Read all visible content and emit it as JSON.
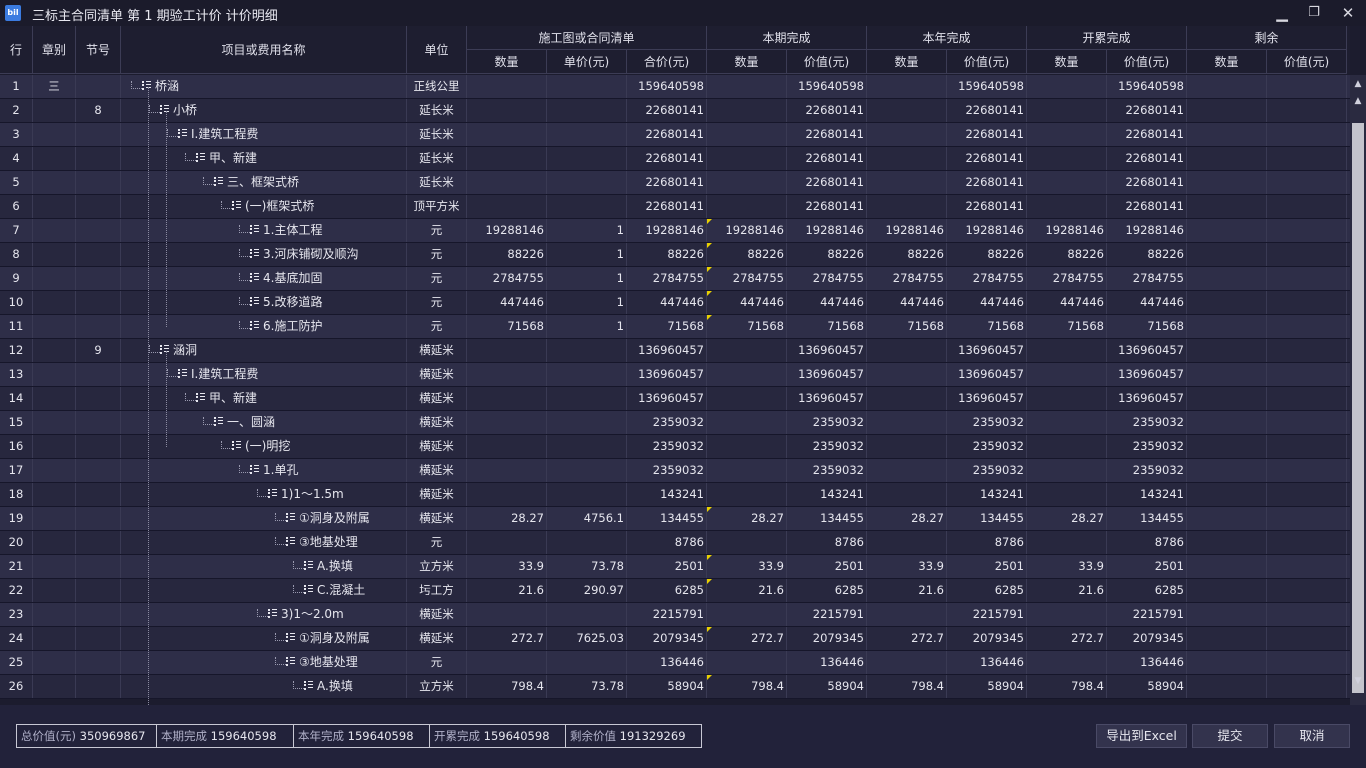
{
  "window": {
    "title": "三标主合同清单 第 1 期验工计价 计价明细",
    "app_icon_text": "bil",
    "minimize": "▁",
    "restore": "❐",
    "close": "✕"
  },
  "header": {
    "col_row": "行",
    "col_chapter": "章别",
    "col_section": "节号",
    "col_name": "项目或费用名称",
    "col_unit": "单位",
    "group_contract": "施工图或合同清单",
    "group_period": "本期完成",
    "group_year": "本年完成",
    "group_cumulative": "开累完成",
    "group_remaining": "剩余",
    "qty": "数量",
    "unit_price": "单价(元)",
    "total_price": "合价(元)",
    "value": "价值(元)"
  },
  "rows": [
    {
      "n": "1",
      "ch": "三",
      "sec": "",
      "lvl": 0,
      "name": "桥涵",
      "unit": "正线公里",
      "q": "",
      "p": "",
      "t": "159640598",
      "pq": "",
      "pv": "159640598",
      "yq": "",
      "yv": "159640598",
      "cq": "",
      "cv": "159640598",
      "flag": false
    },
    {
      "n": "2",
      "ch": "",
      "sec": "8",
      "lvl": 1,
      "name": "小桥",
      "unit": "延长米",
      "q": "",
      "p": "",
      "t": "22680141",
      "pq": "",
      "pv": "22680141",
      "yq": "",
      "yv": "22680141",
      "cq": "",
      "cv": "22680141",
      "flag": false
    },
    {
      "n": "3",
      "ch": "",
      "sec": "",
      "lvl": 2,
      "name": "Ⅰ.建筑工程费",
      "unit": "延长米",
      "q": "",
      "p": "",
      "t": "22680141",
      "pq": "",
      "pv": "22680141",
      "yq": "",
      "yv": "22680141",
      "cq": "",
      "cv": "22680141",
      "flag": false
    },
    {
      "n": "4",
      "ch": "",
      "sec": "",
      "lvl": 3,
      "name": "甲、新建",
      "unit": "延长米",
      "q": "",
      "p": "",
      "t": "22680141",
      "pq": "",
      "pv": "22680141",
      "yq": "",
      "yv": "22680141",
      "cq": "",
      "cv": "22680141",
      "flag": false
    },
    {
      "n": "5",
      "ch": "",
      "sec": "",
      "lvl": 4,
      "name": "三、框架式桥",
      "unit": "延长米",
      "q": "",
      "p": "",
      "t": "22680141",
      "pq": "",
      "pv": "22680141",
      "yq": "",
      "yv": "22680141",
      "cq": "",
      "cv": "22680141",
      "flag": false
    },
    {
      "n": "6",
      "ch": "",
      "sec": "",
      "lvl": 5,
      "name": "(一)框架式桥",
      "unit": "顶平方米",
      "q": "",
      "p": "",
      "t": "22680141",
      "pq": "",
      "pv": "22680141",
      "yq": "",
      "yv": "22680141",
      "cq": "",
      "cv": "22680141",
      "flag": false
    },
    {
      "n": "7",
      "ch": "",
      "sec": "",
      "lvl": 6,
      "name": "1.主体工程",
      "unit": "元",
      "q": "19288146",
      "p": "1",
      "t": "19288146",
      "pq": "19288146",
      "pv": "19288146",
      "yq": "19288146",
      "yv": "19288146",
      "cq": "19288146",
      "cv": "19288146",
      "flag": true
    },
    {
      "n": "8",
      "ch": "",
      "sec": "",
      "lvl": 6,
      "name": "3.河床铺砌及顺沟",
      "unit": "元",
      "q": "88226",
      "p": "1",
      "t": "88226",
      "pq": "88226",
      "pv": "88226",
      "yq": "88226",
      "yv": "88226",
      "cq": "88226",
      "cv": "88226",
      "flag": true
    },
    {
      "n": "9",
      "ch": "",
      "sec": "",
      "lvl": 6,
      "name": "4.基底加固",
      "unit": "元",
      "q": "2784755",
      "p": "1",
      "t": "2784755",
      "pq": "2784755",
      "pv": "2784755",
      "yq": "2784755",
      "yv": "2784755",
      "cq": "2784755",
      "cv": "2784755",
      "flag": true
    },
    {
      "n": "10",
      "ch": "",
      "sec": "",
      "lvl": 6,
      "name": "5.改移道路",
      "unit": "元",
      "q": "447446",
      "p": "1",
      "t": "447446",
      "pq": "447446",
      "pv": "447446",
      "yq": "447446",
      "yv": "447446",
      "cq": "447446",
      "cv": "447446",
      "flag": true
    },
    {
      "n": "11",
      "ch": "",
      "sec": "",
      "lvl": 6,
      "name": "6.施工防护",
      "unit": "元",
      "q": "71568",
      "p": "1",
      "t": "71568",
      "pq": "71568",
      "pv": "71568",
      "yq": "71568",
      "yv": "71568",
      "cq": "71568",
      "cv": "71568",
      "flag": true
    },
    {
      "n": "12",
      "ch": "",
      "sec": "9",
      "lvl": 1,
      "name": "涵洞",
      "unit": "横延米",
      "q": "",
      "p": "",
      "t": "136960457",
      "pq": "",
      "pv": "136960457",
      "yq": "",
      "yv": "136960457",
      "cq": "",
      "cv": "136960457",
      "flag": false
    },
    {
      "n": "13",
      "ch": "",
      "sec": "",
      "lvl": 2,
      "name": "Ⅰ.建筑工程费",
      "unit": "横延米",
      "q": "",
      "p": "",
      "t": "136960457",
      "pq": "",
      "pv": "136960457",
      "yq": "",
      "yv": "136960457",
      "cq": "",
      "cv": "136960457",
      "flag": false
    },
    {
      "n": "14",
      "ch": "",
      "sec": "",
      "lvl": 3,
      "name": "甲、新建",
      "unit": "横延米",
      "q": "",
      "p": "",
      "t": "136960457",
      "pq": "",
      "pv": "136960457",
      "yq": "",
      "yv": "136960457",
      "cq": "",
      "cv": "136960457",
      "flag": false
    },
    {
      "n": "15",
      "ch": "",
      "sec": "",
      "lvl": 4,
      "name": "一、圆涵",
      "unit": "横延米",
      "q": "",
      "p": "",
      "t": "2359032",
      "pq": "",
      "pv": "2359032",
      "yq": "",
      "yv": "2359032",
      "cq": "",
      "cv": "2359032",
      "flag": false
    },
    {
      "n": "16",
      "ch": "",
      "sec": "",
      "lvl": 5,
      "name": "(一)明挖",
      "unit": "横延米",
      "q": "",
      "p": "",
      "t": "2359032",
      "pq": "",
      "pv": "2359032",
      "yq": "",
      "yv": "2359032",
      "cq": "",
      "cv": "2359032",
      "flag": false
    },
    {
      "n": "17",
      "ch": "",
      "sec": "",
      "lvl": 6,
      "name": "1.单孔",
      "unit": "横延米",
      "q": "",
      "p": "",
      "t": "2359032",
      "pq": "",
      "pv": "2359032",
      "yq": "",
      "yv": "2359032",
      "cq": "",
      "cv": "2359032",
      "flag": false
    },
    {
      "n": "18",
      "ch": "",
      "sec": "",
      "lvl": 7,
      "name": "1)1～1.5m",
      "unit": "横延米",
      "q": "",
      "p": "",
      "t": "143241",
      "pq": "",
      "pv": "143241",
      "yq": "",
      "yv": "143241",
      "cq": "",
      "cv": "143241",
      "flag": false
    },
    {
      "n": "19",
      "ch": "",
      "sec": "",
      "lvl": 8,
      "name": "①洞身及附属",
      "unit": "横延米",
      "q": "28.27",
      "p": "4756.1",
      "t": "134455",
      "pq": "28.27",
      "pv": "134455",
      "yq": "28.27",
      "yv": "134455",
      "cq": "28.27",
      "cv": "134455",
      "flag": true
    },
    {
      "n": "20",
      "ch": "",
      "sec": "",
      "lvl": 8,
      "name": "③地基处理",
      "unit": "元",
      "q": "",
      "p": "",
      "t": "8786",
      "pq": "",
      "pv": "8786",
      "yq": "",
      "yv": "8786",
      "cq": "",
      "cv": "8786",
      "flag": false
    },
    {
      "n": "21",
      "ch": "",
      "sec": "",
      "lvl": 9,
      "name": "A.换填",
      "unit": "立方米",
      "q": "33.9",
      "p": "73.78",
      "t": "2501",
      "pq": "33.9",
      "pv": "2501",
      "yq": "33.9",
      "yv": "2501",
      "cq": "33.9",
      "cv": "2501",
      "flag": true
    },
    {
      "n": "22",
      "ch": "",
      "sec": "",
      "lvl": 9,
      "name": "C.混凝土",
      "unit": "圬工方",
      "q": "21.6",
      "p": "290.97",
      "t": "6285",
      "pq": "21.6",
      "pv": "6285",
      "yq": "21.6",
      "yv": "6285",
      "cq": "21.6",
      "cv": "6285",
      "flag": true
    },
    {
      "n": "23",
      "ch": "",
      "sec": "",
      "lvl": 7,
      "name": "3)1～2.0m",
      "unit": "横延米",
      "q": "",
      "p": "",
      "t": "2215791",
      "pq": "",
      "pv": "2215791",
      "yq": "",
      "yv": "2215791",
      "cq": "",
      "cv": "2215791",
      "flag": false
    },
    {
      "n": "24",
      "ch": "",
      "sec": "",
      "lvl": 8,
      "name": "①洞身及附属",
      "unit": "横延米",
      "q": "272.7",
      "p": "7625.03",
      "t": "2079345",
      "pq": "272.7",
      "pv": "2079345",
      "yq": "272.7",
      "yv": "2079345",
      "cq": "272.7",
      "cv": "2079345",
      "flag": true
    },
    {
      "n": "25",
      "ch": "",
      "sec": "",
      "lvl": 8,
      "name": "③地基处理",
      "unit": "元",
      "q": "",
      "p": "",
      "t": "136446",
      "pq": "",
      "pv": "136446",
      "yq": "",
      "yv": "136446",
      "cq": "",
      "cv": "136446",
      "flag": false
    },
    {
      "n": "26",
      "ch": "",
      "sec": "",
      "lvl": 9,
      "name": "A.换填",
      "unit": "立方米",
      "q": "798.4",
      "p": "73.78",
      "t": "58904",
      "pq": "798.4",
      "pv": "58904",
      "yq": "798.4",
      "yv": "58904",
      "cq": "798.4",
      "cv": "58904",
      "flag": true
    }
  ],
  "scrollbar": {
    "up": "▲",
    "up2": "▲",
    "down": "▼"
  },
  "summary": [
    {
      "label": "总价值(元)",
      "value": "350969867"
    },
    {
      "label": "本期完成",
      "value": "159640598"
    },
    {
      "label": "本年完成",
      "value": "159640598"
    },
    {
      "label": "开累完成",
      "value": "159640598"
    },
    {
      "label": "剩余价值",
      "value": "191329269"
    }
  ],
  "buttons": {
    "export": "导出到Excel",
    "submit": "提交",
    "cancel": "取消"
  }
}
